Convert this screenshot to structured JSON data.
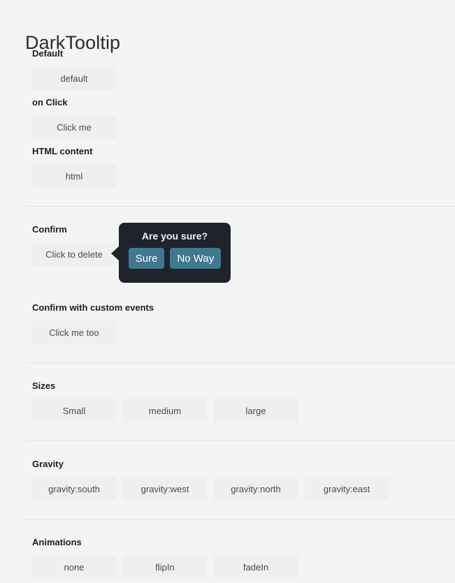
{
  "page": {
    "title": "DarkTooltip",
    "background_color": "#f4f4f4"
  },
  "sections": [
    {
      "heading": "Default",
      "buttons": [
        {
          "label": "default"
        }
      ]
    },
    {
      "heading": "on Click",
      "buttons": [
        {
          "label": "Click me"
        }
      ]
    },
    {
      "heading": "HTML content",
      "buttons": [
        {
          "label": "html"
        }
      ]
    },
    {
      "heading": "Confirm",
      "buttons": [
        {
          "label": "Click to delete"
        }
      ]
    },
    {
      "heading": "Confirm with custom events",
      "buttons": [
        {
          "label": "Click me too"
        }
      ]
    },
    {
      "heading": "Sizes",
      "buttons": [
        {
          "label": "Small"
        },
        {
          "label": "medium"
        },
        {
          "label": "large"
        }
      ]
    },
    {
      "heading": "Gravity",
      "buttons": [
        {
          "label": "gravity:south"
        },
        {
          "label": "gravity:west"
        },
        {
          "label": "gravity:north"
        },
        {
          "label": "gravity:east"
        }
      ]
    },
    {
      "heading": "Animations",
      "buttons": [
        {
          "label": "none"
        },
        {
          "label": "flipIn"
        },
        {
          "label": "fadeIn"
        }
      ]
    }
  ],
  "tooltip": {
    "title": "Are you sure?",
    "confirm_label": "Sure",
    "cancel_label": "No Way",
    "background_color": "#1e232c",
    "button_color": "#41788f",
    "arrow_direction": "left"
  }
}
